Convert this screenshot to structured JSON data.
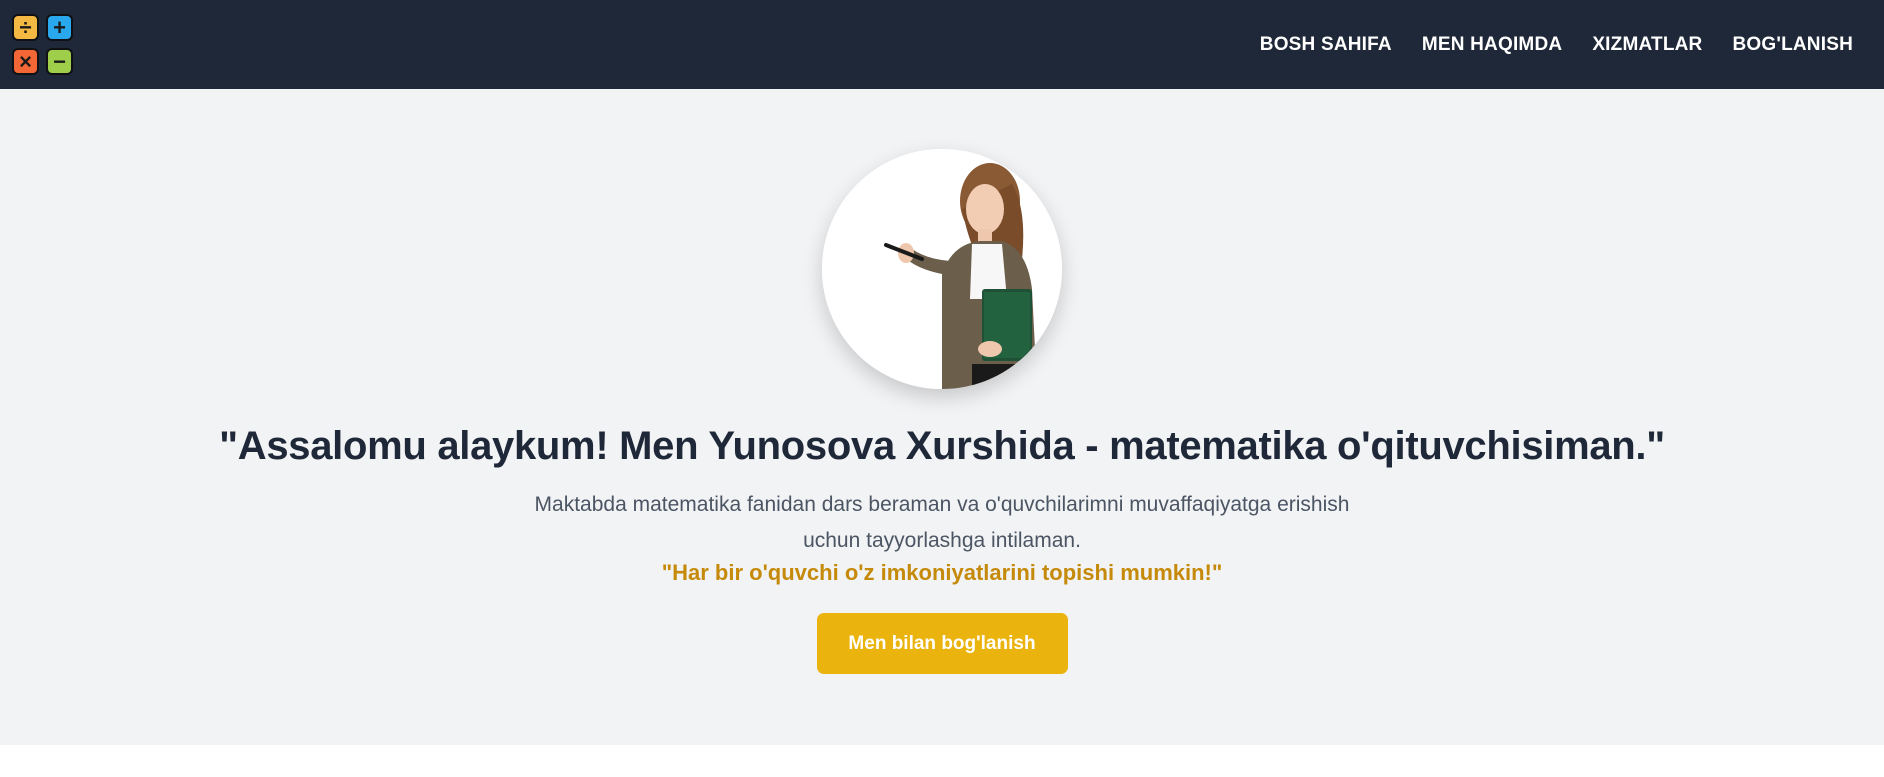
{
  "logo": {
    "tiles": [
      {
        "icon": "divide-icon",
        "symbol": "÷",
        "color": "#f4b942"
      },
      {
        "icon": "plus-icon",
        "symbol": "+",
        "color": "#2aa8ee"
      },
      {
        "icon": "times-icon",
        "symbol": "×",
        "color": "#f26735"
      },
      {
        "icon": "minus-icon",
        "symbol": "−",
        "color": "#9fcf4a"
      }
    ]
  },
  "nav": {
    "items": [
      "BOSH SAHIFA",
      "MEN HAQIMDA",
      "XIZMATLAR",
      "BOG'LANISH"
    ]
  },
  "hero": {
    "headline": "\"Assalomu alaykum! Men Yunosova Xurshida - matematika o'qituvchisiman.\"",
    "lead": "Maktabda matematika fanidan dars beraman va o'quvchilarimni muvaffaqiyatga erishish uchun tayyorlashga intilaman.",
    "quote": "\"Har bir o'quvchi o'z imkoniyatlarini topishi mumkin!\"",
    "cta_label": "Men bilan bog'lanish"
  },
  "colors": {
    "header_bg": "#1f2838",
    "hero_bg": "#f2f3f5",
    "accent": "#ebb30e",
    "quote": "#c68a0a"
  }
}
